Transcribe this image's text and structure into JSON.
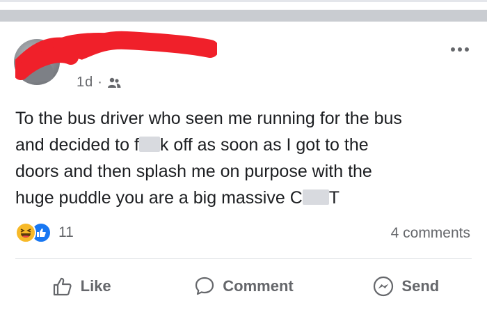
{
  "post": {
    "time": "1d",
    "separator": "·",
    "audience_icon": "friends-icon",
    "menu_icon": "more-options-icon",
    "text": {
      "line1": "To the bus driver who seen me running for the bus",
      "line2_a": "and decided to f",
      "line2_b": "k off as soon as I got to the",
      "line3": "doors and then splash me on purpose with the",
      "line4_a": "huge puddle you are a big massive C",
      "line4_b": "T"
    },
    "reactions": {
      "types": [
        "haha",
        "like"
      ],
      "count": "11"
    },
    "comments": "4 comments"
  },
  "actions": {
    "like": "Like",
    "comment": "Comment",
    "send": "Send"
  },
  "colors": {
    "divider": "#c9ccd1",
    "muted_text": "#65676b",
    "like_blue": "#1877f2",
    "haha_yellow": "#f7b928",
    "redaction_red": "#f0202a"
  }
}
